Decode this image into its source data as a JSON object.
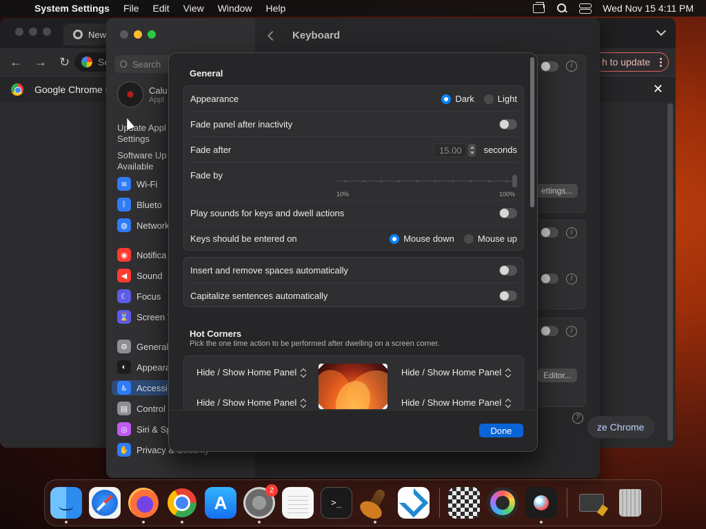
{
  "menubar": {
    "app": "System Settings",
    "menus": [
      "File",
      "Edit",
      "View",
      "Window",
      "Help"
    ],
    "datetime": "Wed Nov 15  4:11 PM"
  },
  "chrome": {
    "tab_title": "New",
    "omnibox_text": "Se",
    "relaunch_label": "h to update",
    "infobar_text": "Google Chrome i",
    "optimize_label": "ze Chrome",
    "settings_btn": "ettings...",
    "editor_btn": "Editor..."
  },
  "settings": {
    "header_title": "Keyboard",
    "search_placeholder": "Search",
    "user_name": "Calu",
    "user_sub": "Appl",
    "update_text_1": "Update Appl",
    "update_text_2": "Settings",
    "software_update_1": "Software Up",
    "software_update_2": "Available",
    "sidebar": [
      {
        "label": "Wi-Fi",
        "color": "#2f7cf6",
        "glyph": "≋"
      },
      {
        "label": "Blueto",
        "color": "#2f7cf6",
        "glyph": "ᛒ"
      },
      {
        "label": "Network",
        "color": "#2f7cf6",
        "glyph": "◍"
      },
      {
        "label": "Notifica",
        "color": "#ff3b30",
        "glyph": "◉"
      },
      {
        "label": "Sound",
        "color": "#ff3b30",
        "glyph": "◀"
      },
      {
        "label": "Focus",
        "color": "#5e5ce6",
        "glyph": "☾"
      },
      {
        "label": "Screen T",
        "color": "#5e5ce6",
        "glyph": "⌛"
      },
      {
        "label": "General",
        "color": "#8e8e93",
        "glyph": "⚙"
      },
      {
        "label": "Appeara",
        "color": "#1c1c1e",
        "glyph": "◐"
      },
      {
        "label": "Accessi",
        "color": "#2f7cf6",
        "glyph": "♿"
      },
      {
        "label": "Control",
        "color": "#8e8e93",
        "glyph": "▤"
      },
      {
        "label": "Siri & Sp",
        "color": "#bf5af2",
        "glyph": "◎"
      },
      {
        "label": "Privacy & Security",
        "color": "#2f7cf6",
        "glyph": "✋"
      }
    ]
  },
  "dialog": {
    "general_title": "General",
    "appearance_label": "Appearance",
    "appearance_options": [
      "Dark",
      "Light"
    ],
    "appearance_selected": "Dark",
    "fade_panel_label": "Fade panel after inactivity",
    "fade_after_label": "Fade after",
    "fade_after_value": "15.00",
    "fade_after_unit": "seconds",
    "fade_by_label": "Fade by",
    "fade_by_min": "10%",
    "fade_by_max": "100%",
    "fade_by_value_pct": 100,
    "play_sounds_label": "Play sounds for keys and dwell actions",
    "keys_entered_label": "Keys should be entered on",
    "keys_entered_options": [
      "Mouse down",
      "Mouse up"
    ],
    "keys_entered_selected": "Mouse down",
    "insert_spaces_label": "Insert and remove spaces automatically",
    "capitalize_label": "Capitalize sentences automatically",
    "hot_corners_title": "Hot Corners",
    "hot_corners_sub": "Pick the one time action to be performed after dwelling on a screen corner.",
    "corner_tl": "Hide / Show Home Panel",
    "corner_tr": "Hide / Show Home Panel",
    "corner_bl": "Hide / Show Home Panel",
    "corner_br": "Hide / Show Home Panel",
    "done_label": "Done"
  },
  "dock": {
    "system_settings_badge": "2",
    "terminal_glyph": ">_"
  }
}
